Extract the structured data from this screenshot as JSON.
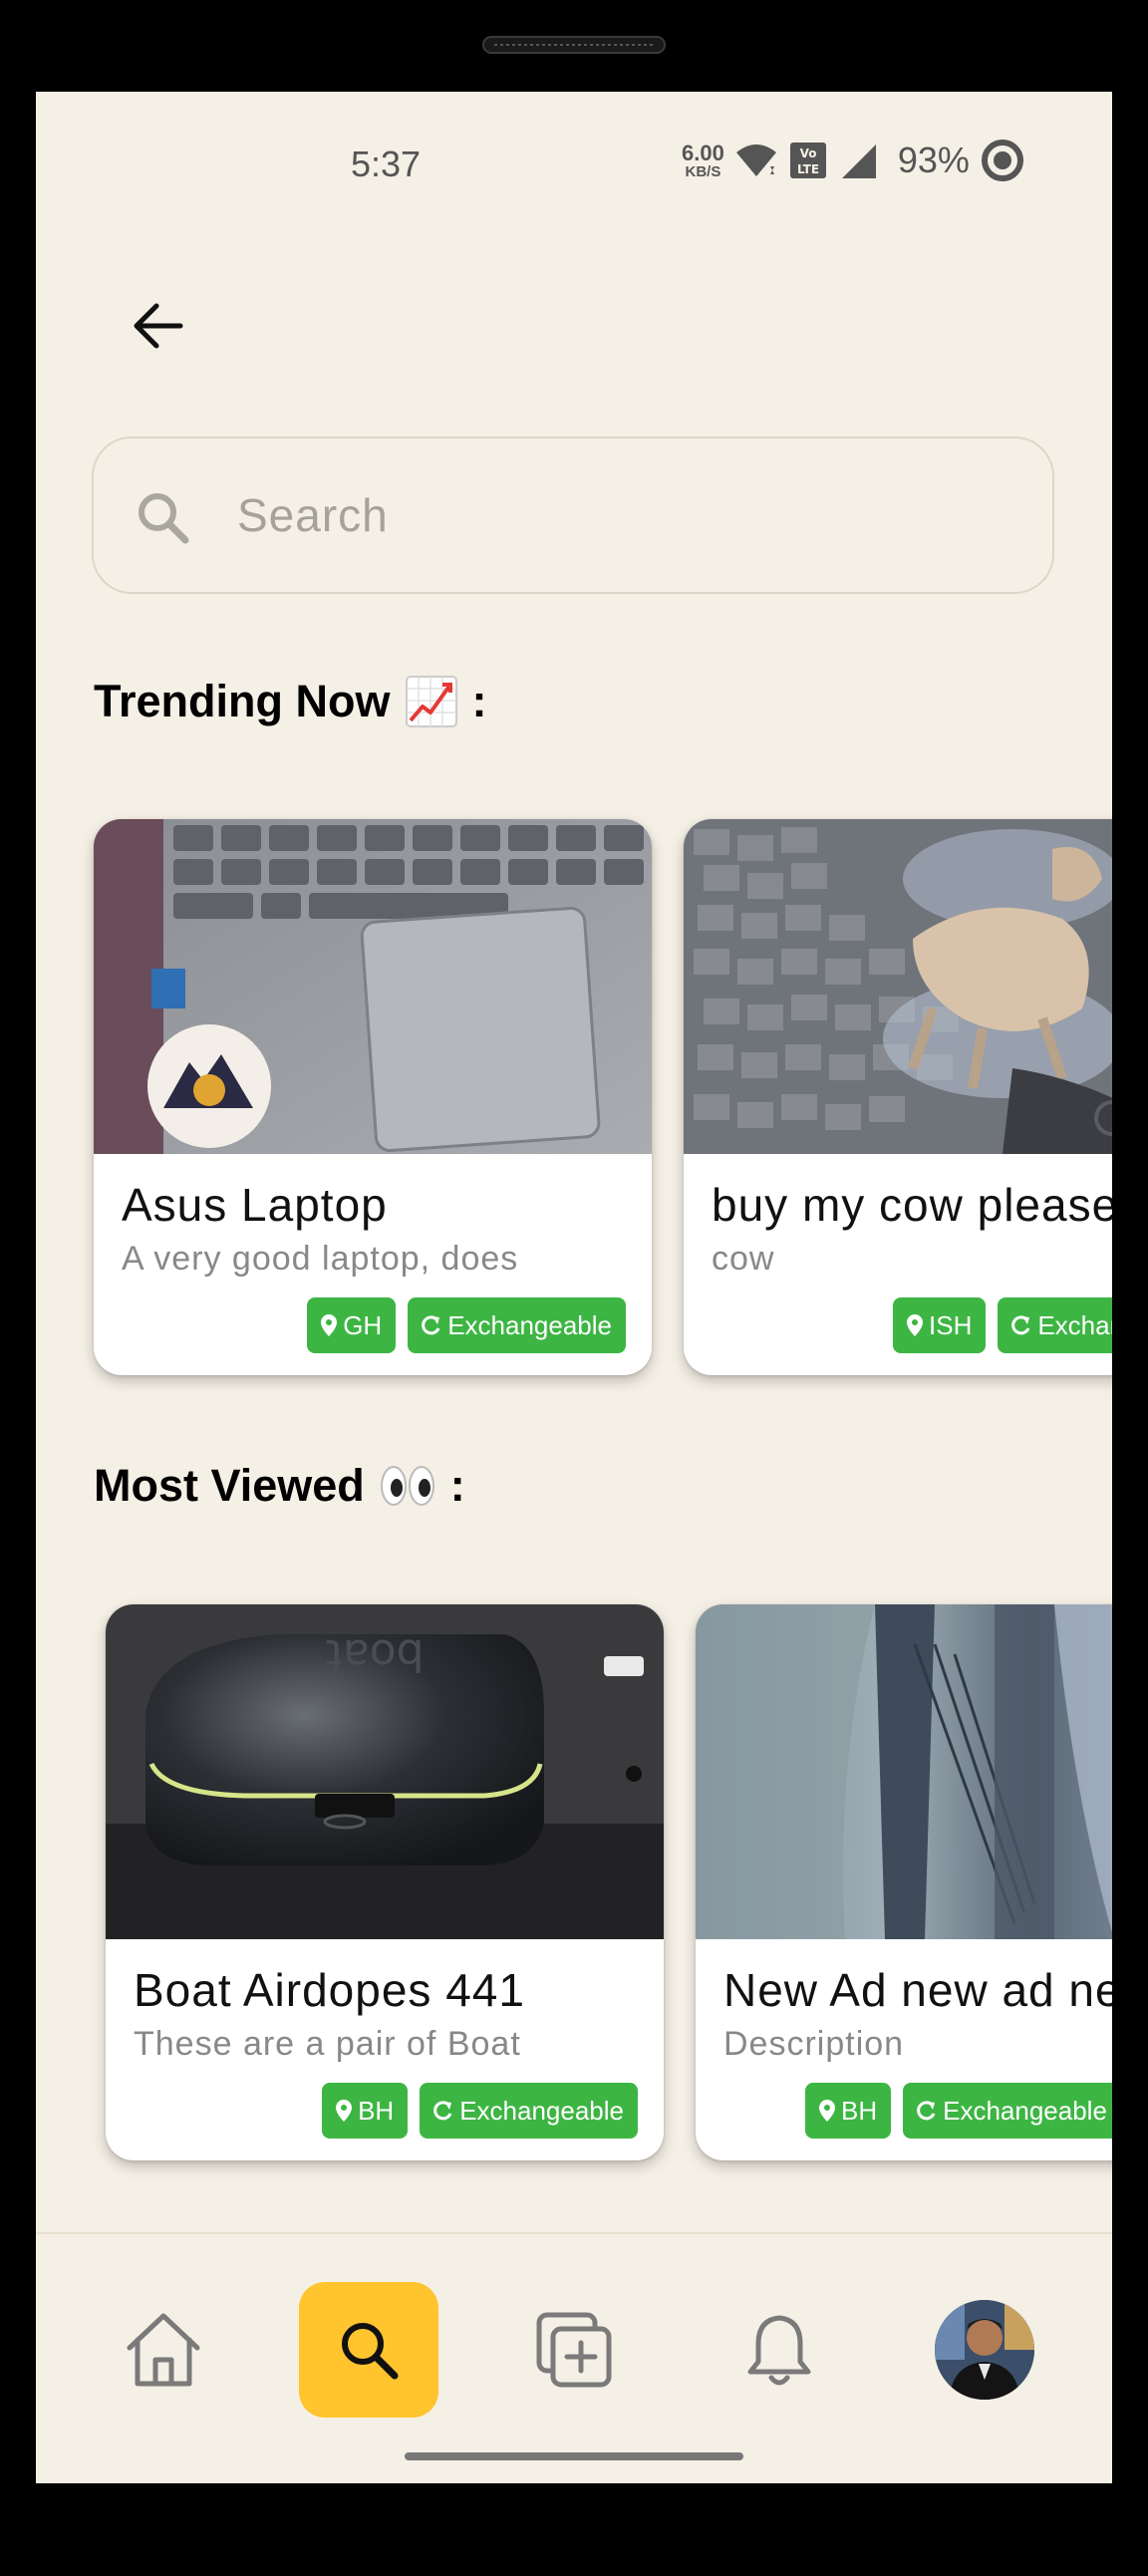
{
  "status_bar": {
    "time": "5:37",
    "net_speed_value": "6.00",
    "net_speed_unit": "KB/S",
    "battery": "93%",
    "icons": [
      "wifi-icon",
      "volte-icon",
      "signal-icon",
      "battery-ring-icon"
    ]
  },
  "header": {
    "back_icon": "arrow-left-icon"
  },
  "search": {
    "placeholder": "Search",
    "value": ""
  },
  "sections": {
    "trending": {
      "title": "Trending Now",
      "emoji": "chart-increasing",
      "suffix": ":",
      "cards": [
        {
          "title": "Asus Laptop",
          "description": "A very good laptop, does",
          "location": "GH",
          "exchange": "Exchangeable"
        },
        {
          "title": "buy my cow please",
          "description": "cow",
          "location": "ISH",
          "exchange": "Exchangeable"
        }
      ]
    },
    "most_viewed": {
      "title": "Most Viewed",
      "emoji": "eyes",
      "suffix": ":",
      "cards": [
        {
          "title": "Boat Airdopes 441",
          "description": "These are a pair of Boat",
          "location": "BH",
          "exchange": "Exchangeable"
        },
        {
          "title": "New Ad new ad new",
          "description": "Description",
          "location": "BH",
          "exchange": "Exchangeable"
        }
      ]
    }
  },
  "bottom_nav": {
    "items": [
      "home",
      "search",
      "add-post",
      "notifications",
      "profile"
    ],
    "active": "search",
    "active_color": "#FFC42E"
  },
  "colors": {
    "background": "#F5F0E6",
    "tag_green": "#3DB543"
  }
}
